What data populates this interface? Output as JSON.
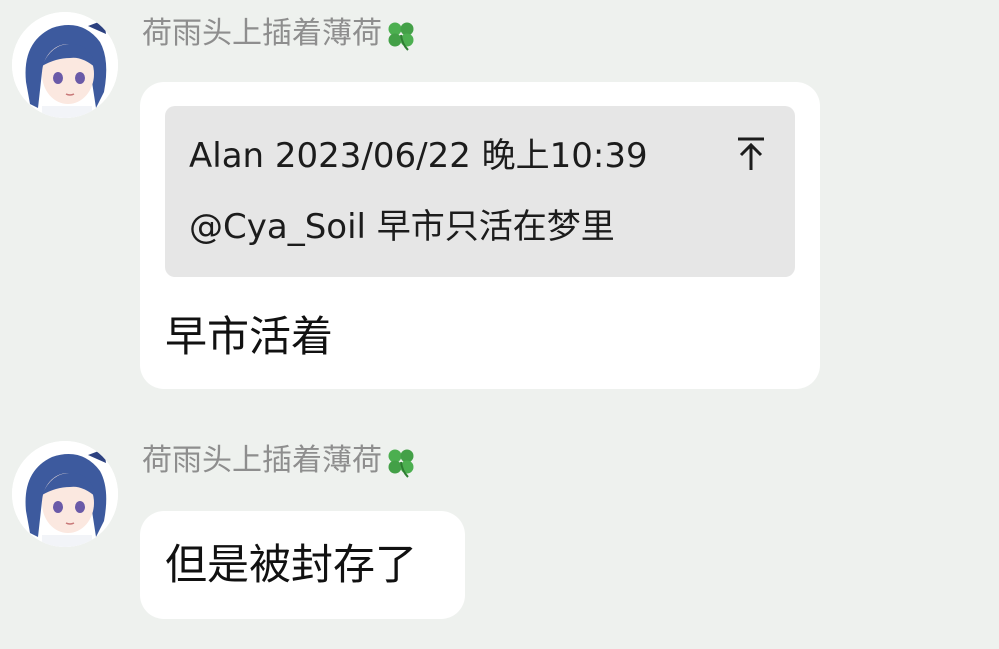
{
  "messages": [
    {
      "sender": "荷雨头上插着薄荷",
      "sender_emoji": "four-leaf-clover",
      "quote": {
        "header": "Alan 2023/06/22 晚上10:39",
        "body": "@Cya_Soil 早市只活在梦里"
      },
      "text": "早市活着"
    },
    {
      "sender": "荷雨头上插着薄荷",
      "sender_emoji": "four-leaf-clover",
      "text": "但是被封存了"
    }
  ],
  "colors": {
    "background": "#eef1ee",
    "bubble": "#ffffff",
    "quote_background": "#e6e6e6",
    "sender_name": "#8e8e8e",
    "avatar_hair": "#3d5a9e"
  }
}
